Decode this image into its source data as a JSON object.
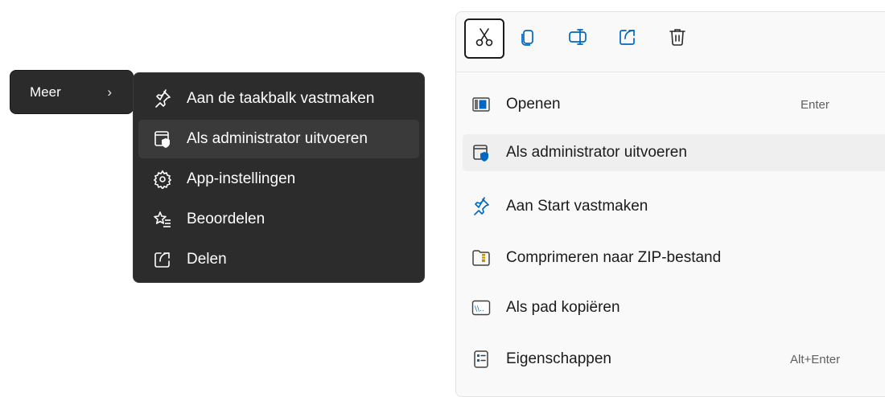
{
  "meer": {
    "label": "Meer",
    "chevron": "›"
  },
  "dark_menu": {
    "items": [
      {
        "label": "Aan de taakbalk vastmaken",
        "icon": "pin-icon"
      },
      {
        "label": "Als administrator uitvoeren",
        "icon": "admin-shield-icon"
      },
      {
        "label": "App-instellingen",
        "icon": "gear-icon"
      },
      {
        "label": "Beoordelen",
        "icon": "rate-star-icon"
      },
      {
        "label": "Delen",
        "icon": "share-icon"
      }
    ]
  },
  "light_menu": {
    "toolbar": [
      "cut-icon",
      "copy-icon",
      "rename-icon",
      "share-icon",
      "delete-icon"
    ],
    "items": [
      {
        "label": "Openen",
        "shortcut": "Enter",
        "icon": "open-window-icon"
      },
      {
        "label": "Als administrator uitvoeren",
        "shortcut": "",
        "icon": "admin-shield-icon"
      },
      {
        "label": "Aan Start vastmaken",
        "shortcut": "",
        "icon": "pin-icon"
      },
      {
        "label": "Comprimeren naar ZIP-bestand",
        "shortcut": "",
        "icon": "zip-folder-icon"
      },
      {
        "label": "Als pad kopiëren",
        "shortcut": "",
        "icon": "copy-path-icon"
      },
      {
        "label": "Eigenschappen",
        "shortcut": "Alt+Enter",
        "icon": "properties-icon"
      }
    ]
  },
  "colors": {
    "dark_bg": "#2c2c2c",
    "dark_hover": "#3a3a3a",
    "light_bg": "#f9f9f9",
    "light_hover": "#efefef",
    "accent_blue": "#0067c0"
  }
}
